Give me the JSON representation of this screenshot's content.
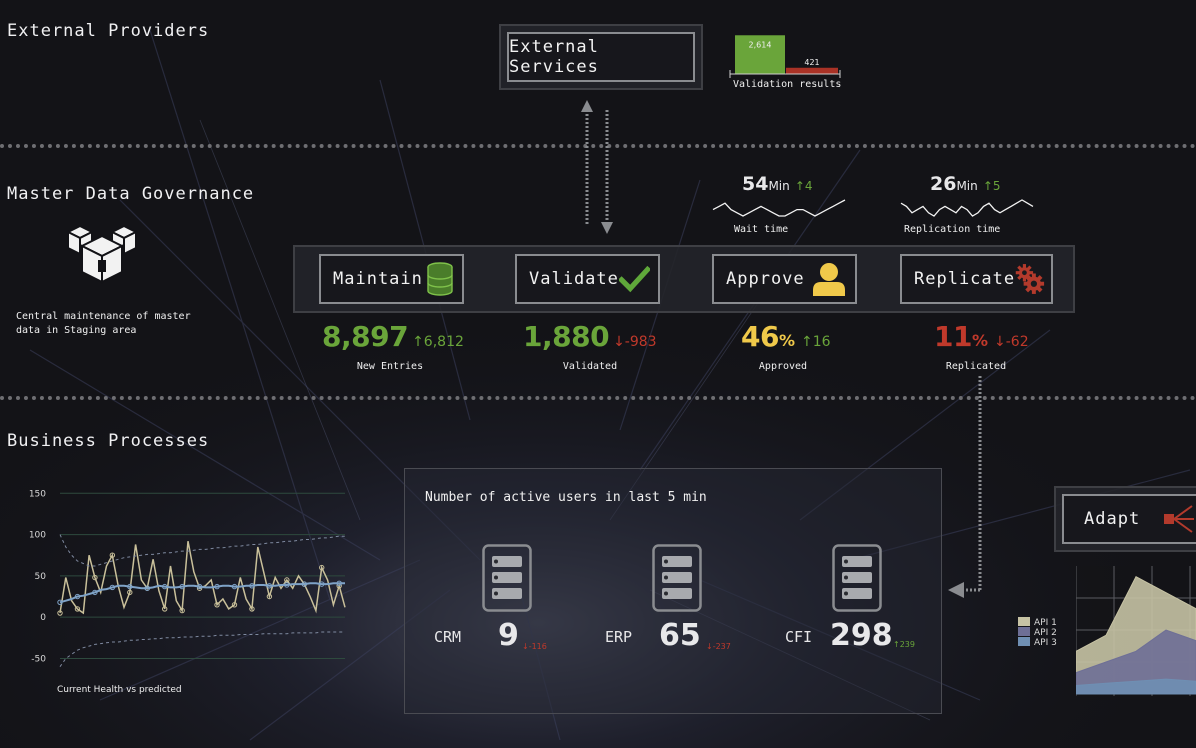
{
  "sections": {
    "external": "External Providers",
    "mdg": "Master Data Governance",
    "business": "Business Processes"
  },
  "external_services": {
    "label": "External Services",
    "validation_chart_caption": "Validation results"
  },
  "mdg": {
    "description_line1": "Central maintenance of master",
    "description_line2": "data in Staging area",
    "wait": {
      "value": "54",
      "unit": "Min",
      "delta": "↑4",
      "label": "Wait time"
    },
    "replication": {
      "value": "26",
      "unit": "Min",
      "delta": "↑5",
      "label": "Replication time"
    },
    "steps": [
      {
        "label": "Maintain",
        "icon": "database-icon",
        "kpi": "8,897",
        "kpi_unit": "",
        "delta": "↑6,812",
        "caption": "New Entries",
        "kpi_color": "#6aa53a",
        "delta_color": "#6aa53a"
      },
      {
        "label": "Validate",
        "icon": "checkmark-icon",
        "kpi": "1,880",
        "kpi_unit": "",
        "delta": "↓-983",
        "caption": "Validated",
        "kpi_color": "#6aa53a",
        "delta_color": "#c0392b"
      },
      {
        "label": "Approve",
        "icon": "user-icon",
        "kpi": "46",
        "kpi_unit": "%",
        "delta": "↑16",
        "caption": "Approved",
        "kpi_color": "#f0c94a",
        "delta_color": "#6aa53a"
      },
      {
        "label": "Replicate",
        "icon": "gears-icon",
        "kpi": "11",
        "kpi_unit": "%",
        "delta": "↓-62",
        "caption": "Replicated",
        "kpi_color": "#c0392b",
        "delta_color": "#c0392b"
      }
    ]
  },
  "active_users": {
    "title": "Number of active users in last 5 min",
    "systems": [
      {
        "name": "CRM",
        "value": "9",
        "delta": "↓-116",
        "delta_color": "#c0392b"
      },
      {
        "name": "ERP",
        "value": "65",
        "delta": "↓-237",
        "delta_color": "#c0392b"
      },
      {
        "name": "CFI",
        "value": "298",
        "delta": "↑239",
        "delta_color": "#6aa53a"
      }
    ]
  },
  "adapt": {
    "label": "Adapt"
  },
  "health_chart_caption": "Current Health vs predicted",
  "colors": {
    "green": "#6aa53a",
    "red": "#c0392b",
    "yellow": "#f0c94a",
    "health_line": "#c9c09a",
    "predicted_line": "#7fa3c8"
  },
  "chart_data": [
    {
      "type": "bar",
      "title": "",
      "caption": "Validation results",
      "categories": [
        "",
        ""
      ],
      "values": [
        2614,
        421
      ],
      "value_labels": [
        "2,614",
        "421"
      ],
      "colors": [
        "#6aa53a",
        "#a93226"
      ],
      "ylim": [
        0,
        2700
      ]
    },
    {
      "type": "line",
      "title": "",
      "caption": "Current Health vs predicted",
      "x": [
        1,
        2,
        3,
        4,
        5,
        6,
        7,
        8,
        9,
        10,
        11,
        12,
        13,
        14,
        15,
        16,
        17,
        18,
        19,
        20,
        21,
        22,
        23,
        24,
        25,
        26,
        27,
        28,
        29,
        30,
        31,
        32,
        33,
        34,
        35,
        36,
        37,
        38,
        39,
        40,
        41,
        42,
        43,
        44,
        45,
        46,
        47,
        48,
        49,
        50
      ],
      "yticks": [
        150,
        100,
        50,
        0,
        -50
      ],
      "ylim": [
        -70,
        160
      ],
      "series": [
        {
          "values": [
            5,
            48,
            20,
            10,
            5,
            75,
            48,
            30,
            62,
            75,
            38,
            12,
            30,
            88,
            45,
            35,
            70,
            32,
            10,
            62,
            20,
            8,
            92,
            55,
            35,
            38,
            45,
            15,
            22,
            10,
            15,
            48,
            22,
            10,
            85,
            55,
            25,
            48,
            35,
            45,
            35,
            50,
            40,
            25,
            8,
            60,
            45,
            15,
            38,
            12
          ]
        },
        {
          "values": [
            18,
            20,
            22,
            25,
            26,
            28,
            30,
            33,
            34,
            36,
            38,
            38,
            37,
            36,
            35,
            35,
            36,
            38,
            37,
            36,
            36,
            37,
            38,
            38,
            37,
            36,
            36,
            37,
            38,
            38,
            37,
            37,
            38,
            38,
            39,
            39,
            38,
            38,
            39,
            39,
            40,
            40,
            40,
            41,
            41,
            40,
            40,
            41,
            41,
            41
          ]
        },
        {
          "values": [
            100,
            85,
            75,
            68,
            65,
            62,
            62,
            64,
            66,
            68,
            70,
            72,
            73,
            74,
            75,
            76,
            76,
            77,
            78,
            78,
            79,
            80,
            80,
            81,
            82,
            82,
            83,
            84,
            84,
            85,
            86,
            86,
            87,
            88,
            88,
            89,
            90,
            90,
            91,
            92,
            92,
            93,
            94,
            94,
            95,
            96,
            96,
            97,
            98,
            98
          ]
        },
        {
          "values": [
            -60,
            -50,
            -45,
            -40,
            -37,
            -35,
            -33,
            -32,
            -31,
            -30,
            -30,
            -29,
            -28,
            -28,
            -27,
            -27,
            -26,
            -26,
            -25,
            -25,
            -25,
            -24,
            -24,
            -24,
            -23,
            -23,
            -23,
            -22,
            -22,
            -22,
            -22,
            -21,
            -21,
            -21,
            -21,
            -20,
            -20,
            -20,
            -20,
            -20,
            -19,
            -19,
            -19,
            -19,
            -19,
            -18,
            -18,
            -18,
            -18,
            -18
          ]
        }
      ]
    },
    {
      "type": "area",
      "title": "",
      "x": [
        0,
        1,
        2,
        3,
        4
      ],
      "series": [
        {
          "name": "API 1",
          "values": [
            40,
            55,
            110,
            95,
            80
          ],
          "color": "#c7c3a4"
        },
        {
          "name": "API 2",
          "values": [
            20,
            30,
            40,
            60,
            50
          ],
          "color": "#6e6f96"
        },
        {
          "name": "API 3",
          "values": [
            8,
            10,
            12,
            14,
            12
          ],
          "color": "#6f8fb3"
        }
      ],
      "ylim": [
        0,
        120
      ]
    },
    {
      "type": "line",
      "title": "",
      "caption": "Wait time",
      "series": [
        {
          "values": [
            5,
            6,
            7,
            5,
            4,
            3,
            4,
            5,
            6,
            5,
            4,
            3,
            3,
            4,
            5,
            5,
            4,
            3,
            4,
            5,
            6,
            7,
            8
          ]
        }
      ]
    },
    {
      "type": "line",
      "title": "",
      "caption": "Replication time",
      "series": [
        {
          "values": [
            6,
            5,
            3,
            4,
            5,
            3,
            2,
            4,
            5,
            4,
            3,
            5,
            4,
            2,
            3,
            5,
            6,
            4,
            3,
            4,
            5,
            6,
            7,
            6,
            5
          ]
        }
      ]
    }
  ]
}
